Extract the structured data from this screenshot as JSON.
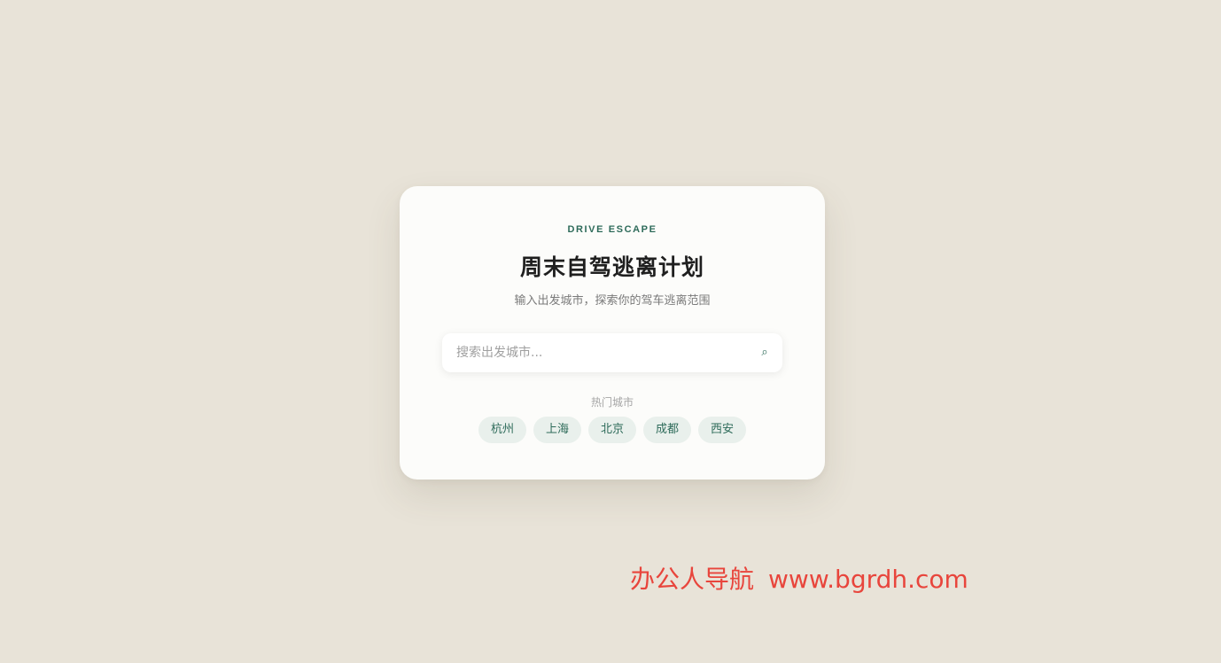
{
  "card": {
    "eyebrow": "DRIVE ESCAPE",
    "title": "周末自驾逃离计划",
    "subtitle": "输入出发城市，探索你的驾车逃离范围"
  },
  "search": {
    "placeholder": "搜索出发城市...",
    "value": "",
    "icon": "search-icon"
  },
  "hot_cities": {
    "label": "热门城市",
    "items": [
      "杭州",
      "上海",
      "北京",
      "成都",
      "西安"
    ]
  },
  "watermark": {
    "name": "办公人导航",
    "url": "www.bgrdh.com"
  },
  "colors": {
    "background": "#e8e3d8",
    "card": "#fcfcfa",
    "accent": "#2e6b5a",
    "chip_bg": "#e9f0ec",
    "watermark": "#e8453c"
  }
}
